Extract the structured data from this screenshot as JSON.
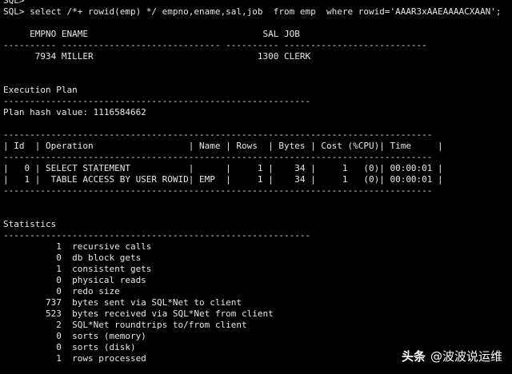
{
  "terminal": {
    "lines": [
      "SQL>",
      "SQL> select /*+ rowid(emp) */ empno,ename,sal,job  from emp  where rowid='AAAR3xAAEAAAACXAAN';",
      "",
      "     EMPNO ENAME                                 SAL JOB",
      "---------- ------------------------------ ---------- ---------------------------",
      "      7934 MILLER                               1300 CLERK",
      "",
      "",
      "Execution Plan",
      "----------------------------------------------------------",
      "Plan hash value: 1116584662",
      "",
      "---------------------------------------------------------------------------------",
      "| Id  | Operation                  | Name | Rows  | Bytes | Cost (%CPU)| Time     |",
      "---------------------------------------------------------------------------------",
      "|   0 | SELECT STATEMENT           |      |     1 |    34 |     1   (0)| 00:00:01 |",
      "|   1 |  TABLE ACCESS BY USER ROWID| EMP  |     1 |    34 |     1   (0)| 00:00:01 |",
      "---------------------------------------------------------------------------------",
      "",
      "",
      "Statistics",
      "----------------------------------------------------------",
      "          1  recursive calls",
      "          0  db block gets",
      "          1  consistent gets",
      "          0  physical reads",
      "          0  redo size",
      "        737  bytes sent via SQL*Net to client",
      "        523  bytes received via SQL*Net from client",
      "          2  SQL*Net roundtrips to/from client",
      "          0  sorts (memory)",
      "          0  sorts (disk)",
      "          1  rows processed"
    ]
  },
  "watermark": {
    "brand": "头条",
    "handle": "@波波说运维"
  },
  "colors": {
    "background": "#000000",
    "text": "#e6e6e6",
    "watermark": "#ffffff"
  }
}
